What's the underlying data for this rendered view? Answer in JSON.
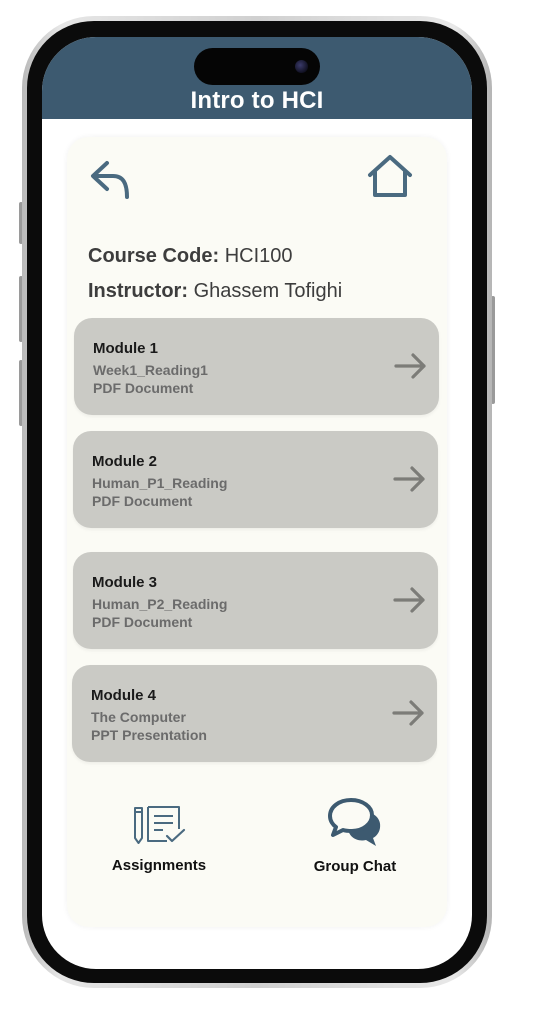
{
  "header": {
    "title": "Intro to HCI"
  },
  "course": {
    "code_label": "Course Code:",
    "code_value": "HCI100",
    "instructor_label": "Instructor:",
    "instructor_value": "Ghassem Tofighi"
  },
  "modules": [
    {
      "title": "Module 1",
      "file": "Week1_Reading1",
      "type": "PDF Document"
    },
    {
      "title": "Module 2",
      "file": "Human_P1_Reading",
      "type": "PDF Document"
    },
    {
      "title": "Module 3",
      "file": "Human_P2_Reading",
      "type": "PDF Document"
    },
    {
      "title": "Module 4",
      "file": "The Computer",
      "type": "PPT Presentation"
    }
  ],
  "nav": {
    "assignments_label": "Assignments",
    "group_chat_label": "Group Chat"
  },
  "icons": {
    "back": "back-arrow-icon",
    "home": "home-icon",
    "module_arrow": "arrow-right-icon",
    "assignments": "assignments-icon",
    "chat": "chat-bubbles-icon"
  },
  "colors": {
    "header_bg": "#3d5a70",
    "icon_accent": "#4a6a80",
    "card_bg": "#fbfbf5",
    "module_bg": "#cacac5"
  }
}
